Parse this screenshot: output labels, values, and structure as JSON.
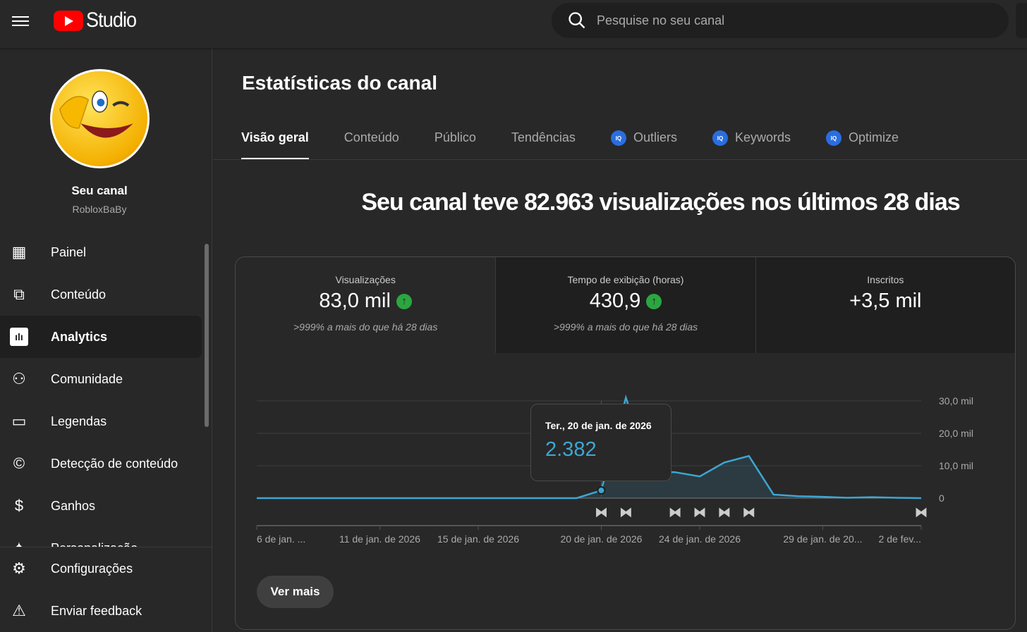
{
  "header": {
    "logo_text": "Studio",
    "search_placeholder": "Pesquise no seu canal"
  },
  "channel": {
    "name": "Seu canal",
    "handle": "RobloxBaBy"
  },
  "nav": [
    {
      "label": "Painel",
      "icon": "dashboard-icon"
    },
    {
      "label": "Conteúdo",
      "icon": "content-icon"
    },
    {
      "label": "Analytics",
      "icon": "analytics-icon",
      "active": true
    },
    {
      "label": "Comunidade",
      "icon": "community-icon"
    },
    {
      "label": "Legendas",
      "icon": "subtitles-icon"
    },
    {
      "label": "Detecção de conteúdo",
      "icon": "copyright-icon"
    },
    {
      "label": "Ganhos",
      "icon": "dollar-icon"
    },
    {
      "label": "Personalização",
      "icon": "sparkle-icon"
    }
  ],
  "bottom_nav": [
    {
      "label": "Configurações",
      "icon": "gear-icon"
    },
    {
      "label": "Enviar feedback",
      "icon": "feedback-icon"
    }
  ],
  "page": {
    "title": "Estatísticas do canal",
    "headline": "Seu canal teve 82.963 visualizações nos últimos 28 dias"
  },
  "tabs": [
    {
      "label": "Visão geral",
      "active": true
    },
    {
      "label": "Conteúdo"
    },
    {
      "label": "Público"
    },
    {
      "label": "Tendências"
    },
    {
      "label": "Outliers",
      "badge": "IQ"
    },
    {
      "label": "Keywords",
      "badge": "IQ"
    },
    {
      "label": "Optimize",
      "badge": "IQ"
    }
  ],
  "metrics": [
    {
      "label": "Visualizações",
      "value": "83,0 mil",
      "trend": "up",
      "delta": ">999% a mais do que há 28 dias"
    },
    {
      "label": "Tempo de exibição (horas)",
      "value": "430,9",
      "trend": "up",
      "delta": ">999% a mais do que há 28 dias"
    },
    {
      "label": "Inscritos",
      "value": "+3,5 mil"
    }
  ],
  "tooltip": {
    "date": "Ter., 20 de jan. de 2026",
    "value": "2.382"
  },
  "more_label": "Ver mais",
  "colors": {
    "line": "#3ea6d3",
    "up": "#2ba640",
    "accent": "#2a6de0"
  },
  "chart_data": {
    "type": "area",
    "ylim": [
      0,
      30000
    ],
    "yticks": [
      "0",
      "10,0 mil",
      "20,0 mil",
      "30,0 mil"
    ],
    "ytick_values": [
      0,
      10000,
      20000,
      30000
    ],
    "xtick_labels": [
      {
        "label": "6 de jan. ...",
        "index": 0
      },
      {
        "label": "11 de jan. de 2026",
        "index": 5
      },
      {
        "label": "15 de jan. de 2026",
        "index": 9
      },
      {
        "label": "20 de jan. de 2026",
        "index": 14
      },
      {
        "label": "24 de jan. de 2026",
        "index": 18
      },
      {
        "label": "29 de jan. de 20...",
        "index": 23
      },
      {
        "label": "2 de fev...",
        "index": 27
      }
    ],
    "values": [
      0,
      0,
      0,
      0,
      0,
      0,
      0,
      0,
      0,
      0,
      0,
      0,
      0,
      0,
      2382,
      31000,
      8300,
      8000,
      6700,
      11000,
      13000,
      1100,
      600,
      400,
      100,
      300,
      100,
      0
    ],
    "highlight_index": 14,
    "video_markers": [
      14,
      15,
      17,
      18,
      19,
      20,
      27
    ]
  }
}
